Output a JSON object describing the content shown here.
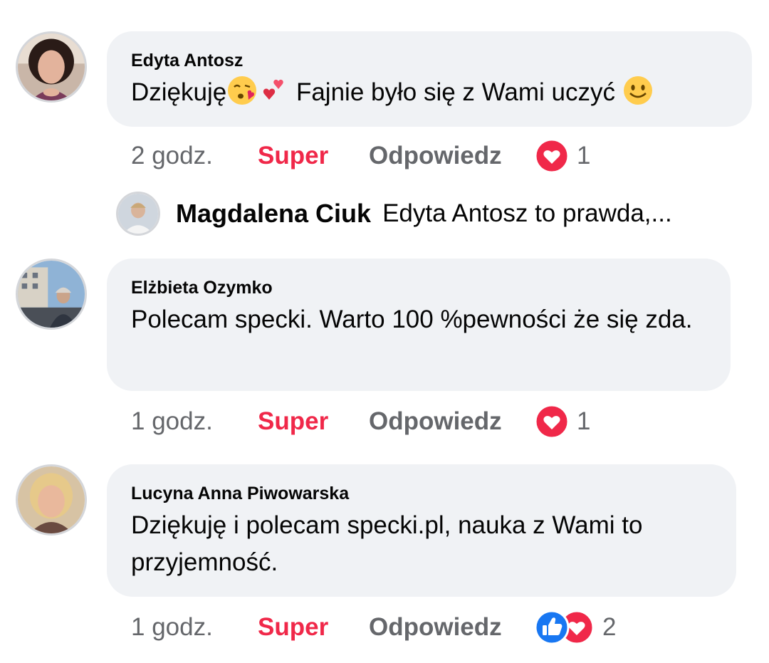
{
  "comments": [
    {
      "author": "Edyta Antosz",
      "text_before_emoji": "Dziękuję",
      "text_after_emoji": " Fajnie było się z Wami uczyć ",
      "time": "2 godz.",
      "like_label": "Super",
      "reply_label": "Odpowiedz",
      "reaction_count": "1",
      "emojis": [
        "face-blowing-kiss-icon",
        "two-hearts-icon",
        "smiling-face-icon"
      ]
    },
    {
      "author": "Elżbieta Ozymko",
      "text": "Polecam specki. Warto 100 %pewności że się zda.",
      "time": "1 godz.",
      "like_label": "Super",
      "reply_label": "Odpowiedz",
      "reaction_count": "1"
    },
    {
      "author": "Lucyna Anna Piwowarska",
      "text": "Dziękuję i polecam specki.pl, nauka z Wami to przyjemność.",
      "time": "1 godz.",
      "like_label": "Super",
      "reply_label": "Odpowiedz",
      "reaction_count": "2"
    }
  ],
  "reply_preview": {
    "author": "Magdalena Ciuk",
    "text": "Edyta Antosz to prawda,..."
  },
  "colors": {
    "bubble": "#f0f2f5",
    "love_red": "#f02849",
    "like_blue": "#1877f2",
    "secondary_text": "#65676b"
  }
}
